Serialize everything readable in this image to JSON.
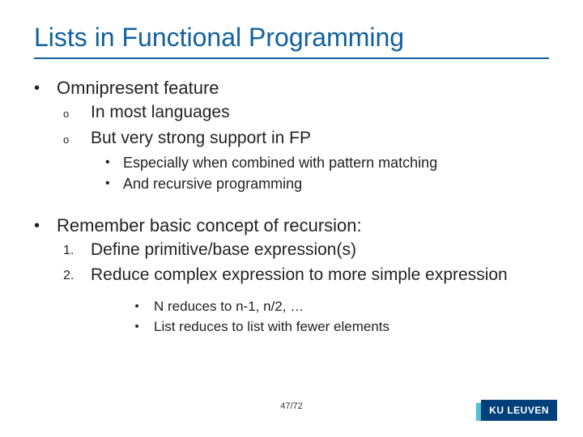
{
  "title": "Lists in Functional Programming",
  "bullets": {
    "a": {
      "text": "Omnipresent feature",
      "sub": {
        "a": "In most languages",
        "b": "But very strong support in FP"
      },
      "subsub": {
        "a": "Especially when combined with pattern matching",
        "b": "And recursive programming"
      }
    },
    "b": {
      "text": "Remember basic concept of recursion:",
      "num": {
        "a": "Define primitive/base expression(s)",
        "b": "Reduce complex expression to more simple expression"
      },
      "subsub": {
        "a": "N reduces to n-1, n/2, …",
        "b": "List reduces to list with fewer elements"
      }
    }
  },
  "markers": {
    "dot": "•",
    "circ": "o",
    "n1": "1.",
    "n2": "2."
  },
  "page": "47/72",
  "logo": "KU LEUVEN"
}
